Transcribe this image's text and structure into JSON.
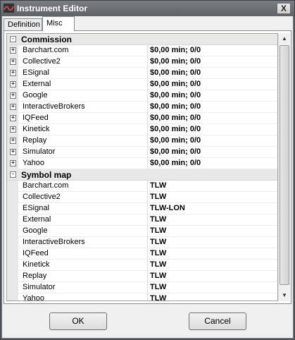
{
  "window": {
    "title": "Instrument Editor",
    "close_glyph": "X"
  },
  "tabs": [
    {
      "label": "Definition",
      "active": false
    },
    {
      "label": "Misc",
      "active": true
    }
  ],
  "grid": {
    "categories": [
      {
        "label": "Commission",
        "expander": "-",
        "items": [
          {
            "name": "Barchart.com",
            "value": "$0,00 min;  0/0",
            "expander": "+"
          },
          {
            "name": "Collective2",
            "value": "$0,00 min;  0/0",
            "expander": "+"
          },
          {
            "name": "ESignal",
            "value": "$0,00 min;  0/0",
            "expander": "+"
          },
          {
            "name": "External",
            "value": "$0,00 min;  0/0",
            "expander": "+"
          },
          {
            "name": "Google",
            "value": "$0,00 min;  0/0",
            "expander": "+"
          },
          {
            "name": "InteractiveBrokers",
            "value": "$0,00 min;  0/0",
            "expander": "+"
          },
          {
            "name": "IQFeed",
            "value": "$0,00 min;  0/0",
            "expander": "+"
          },
          {
            "name": "Kinetick",
            "value": "$0,00 min;  0/0",
            "expander": "+"
          },
          {
            "name": "Replay",
            "value": "$0,00 min;  0/0",
            "expander": "+"
          },
          {
            "name": "Simulator",
            "value": "$0,00 min;  0/0",
            "expander": "+"
          },
          {
            "name": "Yahoo",
            "value": "$0,00 min;  0/0",
            "expander": "+"
          }
        ]
      },
      {
        "label": "Symbol map",
        "expander": "-",
        "items": [
          {
            "name": "Barchart.com",
            "value": "TLW",
            "expander": ""
          },
          {
            "name": "Collective2",
            "value": "TLW",
            "expander": ""
          },
          {
            "name": "ESignal",
            "value": "TLW-LON",
            "expander": ""
          },
          {
            "name": "External",
            "value": "TLW",
            "expander": ""
          },
          {
            "name": "Google",
            "value": "TLW",
            "expander": ""
          },
          {
            "name": "InteractiveBrokers",
            "value": "TLW",
            "expander": ""
          },
          {
            "name": "IQFeed",
            "value": "TLW",
            "expander": ""
          },
          {
            "name": "Kinetick",
            "value": "TLW",
            "expander": ""
          },
          {
            "name": "Replay",
            "value": "TLW",
            "expander": ""
          },
          {
            "name": "Simulator",
            "value": "TLW",
            "expander": ""
          },
          {
            "name": "Yahoo",
            "value": "TLW",
            "expander": ""
          }
        ]
      }
    ]
  },
  "scrollbar": {
    "up_glyph": "▲",
    "down_glyph": "▼"
  },
  "buttons": {
    "ok_label": "OK",
    "cancel_label": "Cancel"
  },
  "colors": {
    "titlebar": "#6b6f74",
    "client": "#f0f0f0",
    "category_bg": "#e8e8e8",
    "icon_accent": "#c0392b"
  }
}
